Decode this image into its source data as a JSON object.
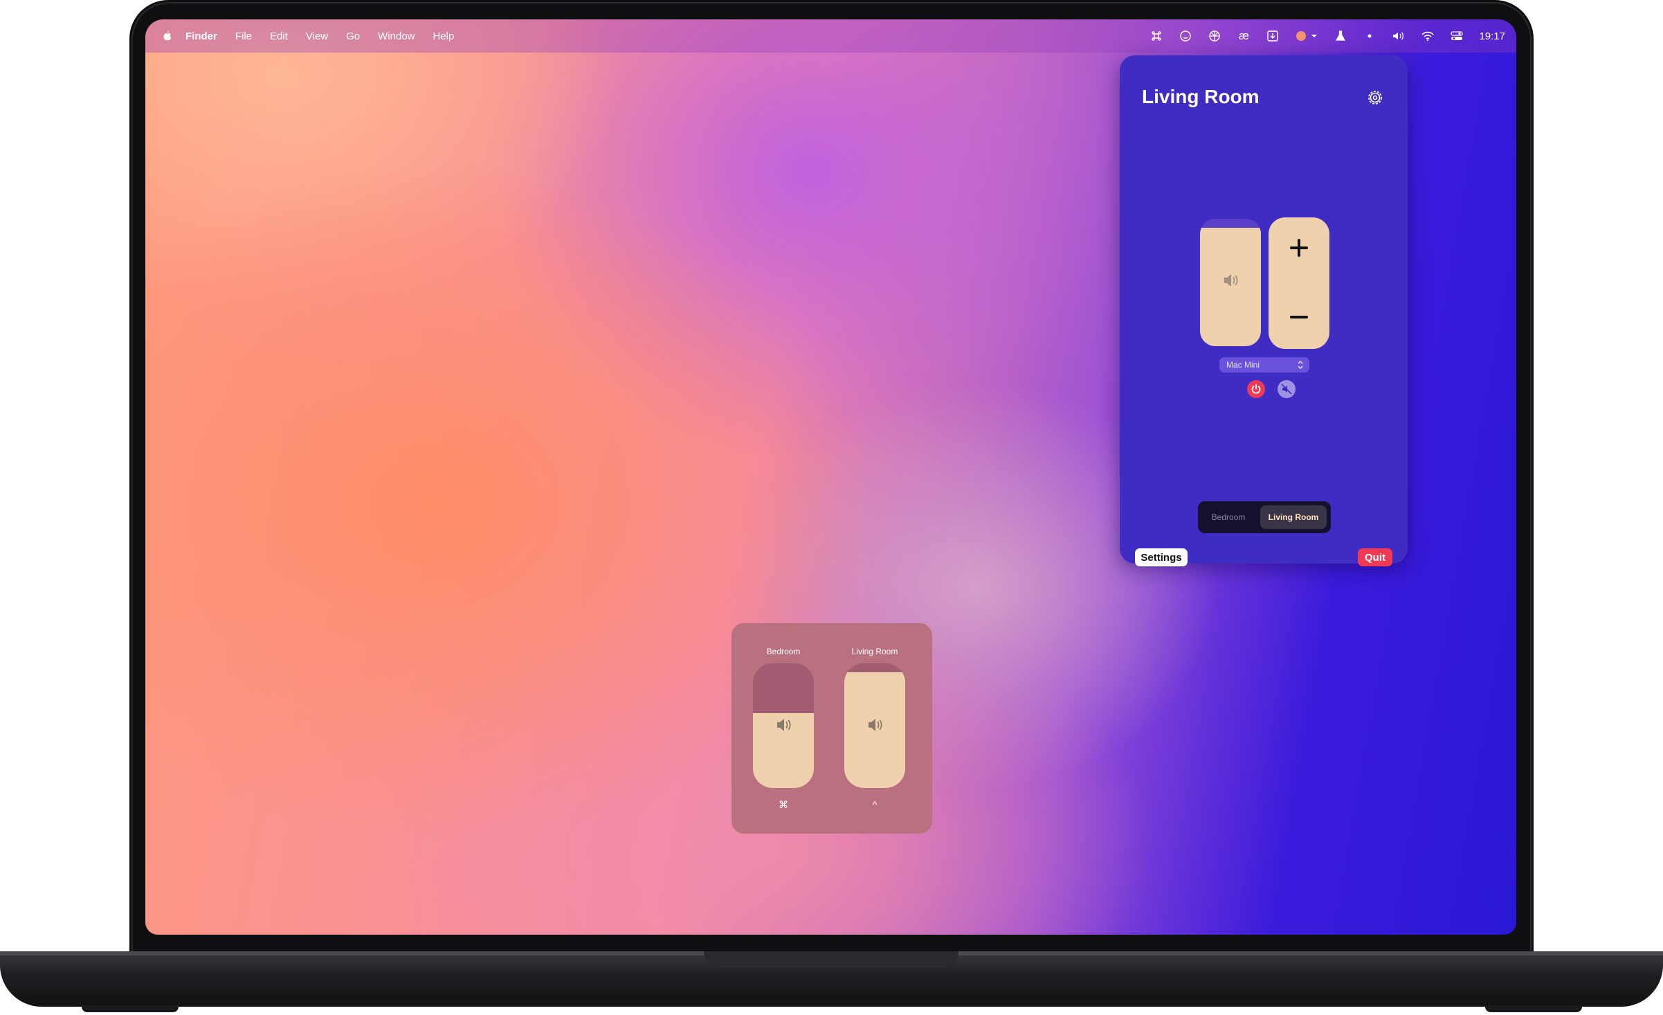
{
  "menubar": {
    "app_name": "Finder",
    "items": [
      "File",
      "Edit",
      "View",
      "Go",
      "Window",
      "Help"
    ],
    "status_icons": [
      "command-icon",
      "smiley-icon",
      "aperture-icon",
      "ae-ligature-icon",
      "download-box-icon",
      "avatar-icon",
      "flask-icon",
      "dot-icon",
      "speaker-icon",
      "wifi-icon",
      "control-center-icon"
    ],
    "ae_glyph": "æ",
    "time": "19:17"
  },
  "panel": {
    "title": "Living Room",
    "volume_level": 0.93,
    "device": "Mac Mini",
    "segments": [
      "Bedroom",
      "Living Room"
    ],
    "selected_segment": "Living Room",
    "settings_label": "Settings",
    "quit_label": "Quit",
    "power_color": "#ef3a55"
  },
  "hud": {
    "speakers": [
      {
        "label": "Bedroom",
        "level": 0.6,
        "shortcut": "⌘"
      },
      {
        "label": "Living Room",
        "level": 0.93,
        "shortcut": "^"
      }
    ]
  },
  "colors": {
    "panel_bg": "#3f2cc2",
    "slider_fill": "#efd1ae",
    "hud_bg": "#b9707f",
    "accent_red": "#ef3a55"
  }
}
